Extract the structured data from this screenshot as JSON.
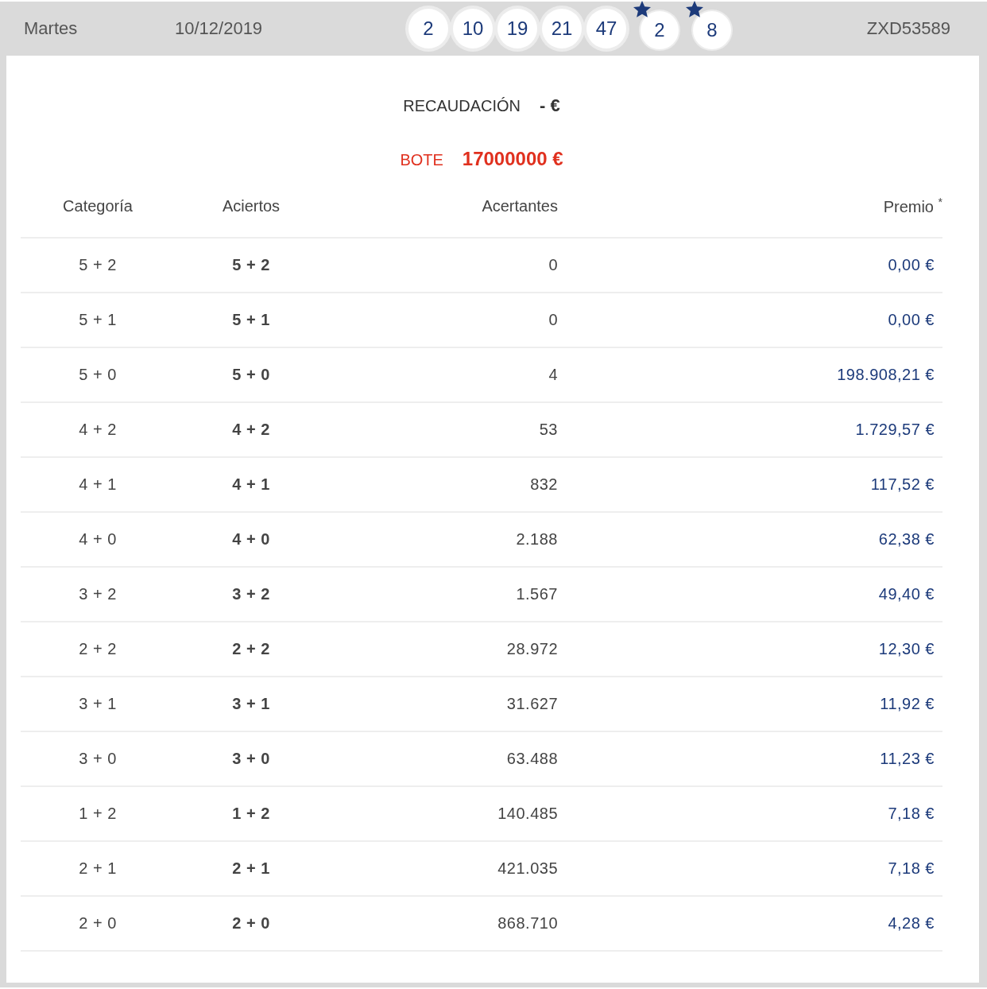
{
  "header": {
    "day": "Martes",
    "date": "10/12/2019",
    "balls": [
      {
        "kind": "number",
        "value": "2"
      },
      {
        "kind": "number",
        "value": "10"
      },
      {
        "kind": "number",
        "value": "19"
      },
      {
        "kind": "number",
        "value": "21"
      },
      {
        "kind": "number",
        "value": "47"
      },
      {
        "kind": "star",
        "value": "2"
      },
      {
        "kind": "star",
        "value": "8"
      }
    ],
    "code": "ZXD53589"
  },
  "recaudacion": {
    "label": "RECAUDACIÓN",
    "value": "- €"
  },
  "bote": {
    "label": "BOTE",
    "value": "17000000 €"
  },
  "table": {
    "columns": [
      "Categoría",
      "Aciertos",
      "Acertantes",
      "Premio $^{*}$"
    ],
    "rows": [
      [
        "5 + 2",
        "5 + 2",
        "0",
        "0,00 €"
      ],
      [
        "5 + 1",
        "5 + 1",
        "0",
        "0,00 €"
      ],
      [
        "5 + 0",
        "5 + 0",
        "4",
        "198.908,21 €"
      ],
      [
        "4 + 2",
        "4 + 2",
        "53",
        "1.729,57 €"
      ],
      [
        "4 + 1",
        "4 + 1",
        "832",
        "117,52 €"
      ],
      [
        "4 + 0",
        "4 + 0",
        "2.188",
        "62,38 €"
      ],
      [
        "3 + 2",
        "3 + 2",
        "1.567",
        "49,40 €"
      ],
      [
        "2 + 2",
        "2 + 2",
        "28.972",
        "12,30 €"
      ],
      [
        "3 + 1",
        "3 + 1",
        "31.627",
        "11,92 €"
      ],
      [
        "3 + 0",
        "3 + 0",
        "63.488",
        "11,23 €"
      ],
      [
        "1 + 2",
        "1 + 2",
        "140.485",
        "7,18 €"
      ],
      [
        "2 + 1",
        "2 + 1",
        "421.035",
        "7,18 €"
      ],
      [
        "2 + 0",
        "2 + 0",
        "868.710",
        "4,28 €"
      ]
    ]
  }
}
